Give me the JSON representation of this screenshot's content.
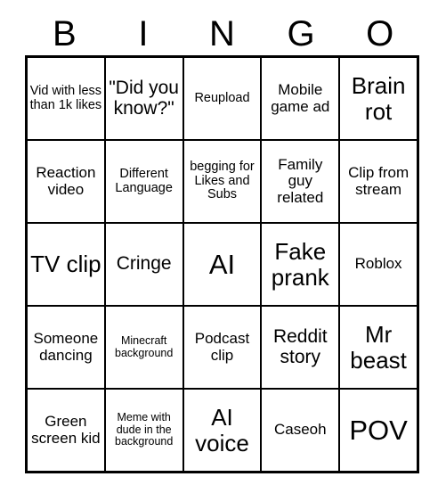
{
  "card": {
    "header_letters": [
      "B",
      "I",
      "N",
      "G",
      "O"
    ],
    "rows": [
      [
        {
          "text": "Vid with less than 1k likes",
          "size": "sm"
        },
        {
          "text": "\"Did you know?\"",
          "size": "lg"
        },
        {
          "text": "Reupload",
          "size": "sm"
        },
        {
          "text": "Mobile game ad",
          "size": "md"
        },
        {
          "text": "Brain rot",
          "size": "xl"
        }
      ],
      [
        {
          "text": "Reaction video",
          "size": "md"
        },
        {
          "text": "Different Language",
          "size": "sm"
        },
        {
          "text": "begging for Likes and Subs",
          "size": "sm"
        },
        {
          "text": "Family guy related",
          "size": "md"
        },
        {
          "text": "Clip from stream",
          "size": "md"
        }
      ],
      [
        {
          "text": "TV clip",
          "size": "xl"
        },
        {
          "text": "Cringe",
          "size": "lg"
        },
        {
          "text": "AI",
          "size": "xxl"
        },
        {
          "text": "Fake prank",
          "size": "xl"
        },
        {
          "text": "Roblox",
          "size": "md"
        }
      ],
      [
        {
          "text": "Someone dancing",
          "size": "md"
        },
        {
          "text": "Minecraft background",
          "size": "xs"
        },
        {
          "text": "Podcast clip",
          "size": "md"
        },
        {
          "text": "Reddit story",
          "size": "lg"
        },
        {
          "text": "Mr beast",
          "size": "xl"
        }
      ],
      [
        {
          "text": "Green screen kid",
          "size": "md"
        },
        {
          "text": "Meme with dude in the background",
          "size": "xs"
        },
        {
          "text": "AI voice",
          "size": "xl"
        },
        {
          "text": "Caseoh",
          "size": "md"
        },
        {
          "text": "POV",
          "size": "xxl"
        }
      ]
    ]
  }
}
